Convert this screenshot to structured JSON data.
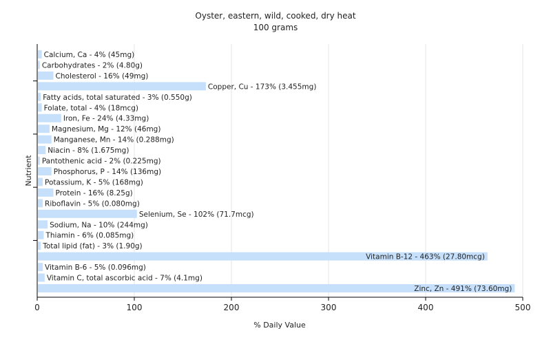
{
  "chart_data": {
    "type": "bar",
    "orientation": "horizontal",
    "title": "Oyster, eastern, wild, cooked, dry heat",
    "subtitle": "100 grams",
    "xlabel": "% Daily Value",
    "ylabel": "Nutrient",
    "xlim": [
      0,
      500
    ],
    "xticks": [
      0,
      100,
      200,
      300,
      400,
      500
    ],
    "grid": "vertical",
    "bar_color": "#c6e0fb",
    "categories": [
      "Calcium, Ca",
      "Carbohydrates",
      "Cholesterol",
      "Copper, Cu",
      "Fatty acids, total saturated",
      "Folate, total",
      "Iron, Fe",
      "Magnesium, Mg",
      "Manganese, Mn",
      "Niacin",
      "Pantothenic acid",
      "Phosphorus, P",
      "Potassium, K",
      "Protein",
      "Riboflavin",
      "Selenium, Se",
      "Sodium, Na",
      "Thiamin",
      "Total lipid (fat)",
      "Vitamin B-12",
      "Vitamin B-6",
      "Vitamin C, total ascorbic acid",
      "Zinc, Zn"
    ],
    "values": [
      4,
      2,
      16,
      173,
      3,
      4,
      24,
      12,
      14,
      8,
      2,
      14,
      5,
      16,
      5,
      102,
      10,
      6,
      3,
      463,
      5,
      7,
      491
    ],
    "labels": [
      "Calcium, Ca - 4% (45mg)",
      "Carbohydrates - 2% (4.80g)",
      "Cholesterol - 16% (49mg)",
      "Copper, Cu - 173% (3.455mg)",
      "Fatty acids, total saturated - 3% (0.550g)",
      "Folate, total - 4% (18mcg)",
      "Iron, Fe - 24% (4.33mg)",
      "Magnesium, Mg - 12% (46mg)",
      "Manganese, Mn - 14% (0.288mg)",
      "Niacin - 8% (1.675mg)",
      "Pantothenic acid - 2% (0.225mg)",
      "Phosphorus, P - 14% (136mg)",
      "Potassium, K - 5% (168mg)",
      "Protein - 16% (8.25g)",
      "Riboflavin - 5% (0.080mg)",
      "Selenium, Se - 102% (71.7mcg)",
      "Sodium, Na - 10% (244mg)",
      "Thiamin - 6% (0.085mg)",
      "Total lipid (fat) - 3% (1.90g)",
      "Vitamin B-12 - 463% (27.80mcg)",
      "Vitamin B-6 - 5% (0.096mg)",
      "Vitamin C, total ascorbic acid - 7% (4.1mg)",
      "Zinc, Zn - 491% (73.60mg)"
    ]
  }
}
